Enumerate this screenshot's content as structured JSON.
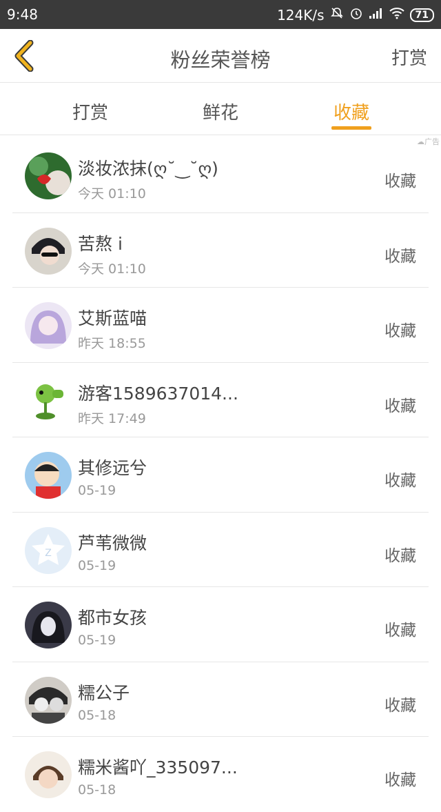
{
  "status_bar": {
    "time": "9:48",
    "network_speed": "124K/s",
    "battery": "71",
    "icons": [
      "mute-icon",
      "alarm-icon",
      "signal-icon",
      "wifi-icon",
      "battery-icon"
    ]
  },
  "header": {
    "title": "粉丝荣誉榜",
    "action_label": "打赏",
    "back_icon": "chevron-left-icon",
    "accent_color": "#f0a01e"
  },
  "tabs": [
    {
      "label": "打赏",
      "active": false
    },
    {
      "label": "鲜花",
      "active": false
    },
    {
      "label": "收藏",
      "active": true
    }
  ],
  "ad_label": "广告",
  "list": [
    {
      "name": "淡妆浓抹(ღ˘‿˘ღ)",
      "time": "今天 01:10",
      "action": "收藏"
    },
    {
      "name": "苦熬 i",
      "time": "今天 01:10",
      "action": "收藏"
    },
    {
      "name": "艾斯蓝喵",
      "time": "昨天 18:55",
      "action": "收藏"
    },
    {
      "name": "游客1589637014...",
      "time": "昨天 17:49",
      "action": "收藏"
    },
    {
      "name": "其修远兮",
      "time": "05-19",
      "action": "收藏"
    },
    {
      "name": "芦苇微微",
      "time": "05-19",
      "action": "收藏"
    },
    {
      "name": "都市女孩",
      "time": "05-19",
      "action": "收藏"
    },
    {
      "name": "糯公子",
      "time": "05-18",
      "action": "收藏"
    },
    {
      "name": "糯米酱吖_335097...",
      "time": "05-18",
      "action": "收藏"
    }
  ]
}
